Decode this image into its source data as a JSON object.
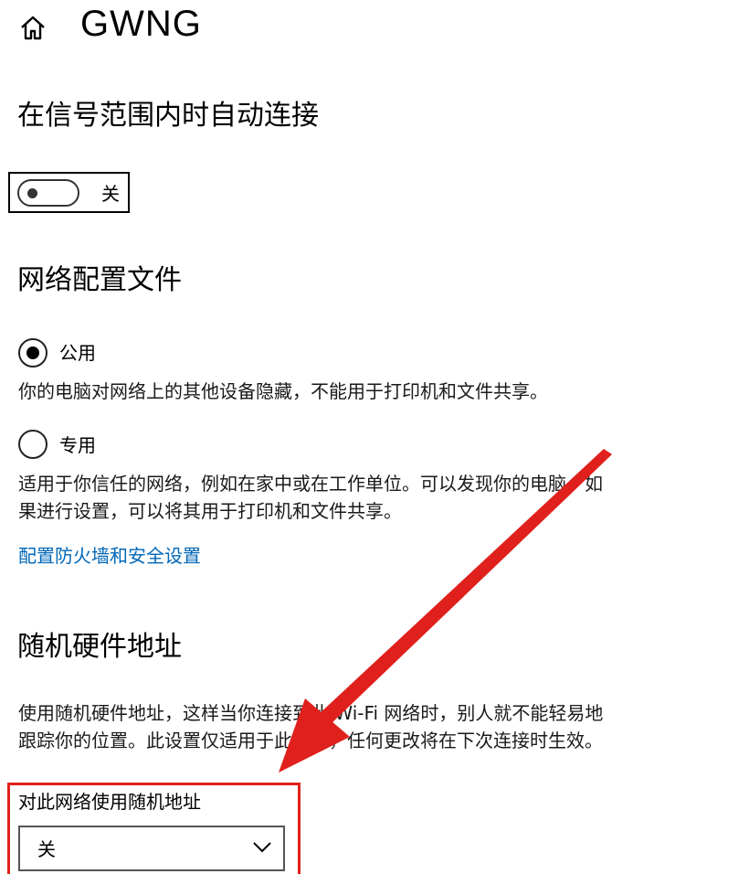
{
  "header": {
    "title": "GWNG",
    "home_icon": "home-icon"
  },
  "auto_connect": {
    "heading": "在信号范围内时自动连接",
    "toggle_state_label": "关",
    "toggle_on": false
  },
  "network_profile": {
    "heading": "网络配置文件",
    "options": [
      {
        "label": "公用",
        "selected": true,
        "description": "你的电脑对网络上的其他设备隐藏，不能用于打印机和文件共享。"
      },
      {
        "label": "专用",
        "selected": false,
        "description_line1": "适用于你信任的网络，例如在家中或在工作单位。可以发现你的电脑，如",
        "description_line2": "果进行设置，可以将其用于打印机和文件共享。"
      }
    ],
    "firewall_link": "配置防火墙和安全设置"
  },
  "random_hw": {
    "heading": "随机硬件地址",
    "description_line1": "使用随机硬件地址，这样当你连接到此 Wi-Fi 网络时，别人就不能轻易地",
    "description_line2": "跟踪你的位置。此设置仅适用于此网络，任何更改将在下次连接时生效。",
    "dropdown_label": "对此网络使用随机地址",
    "dropdown_value": "关"
  },
  "colors": {
    "accent_link": "#0067b8",
    "annotation_red": "#e0201c"
  }
}
